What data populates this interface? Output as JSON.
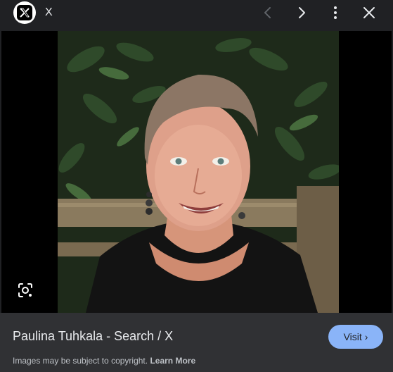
{
  "header": {
    "source_name": "X",
    "logo_glyph": "𝕏",
    "logo_icon": "x-logo-icon",
    "icons": {
      "previous": "chevron-left-icon",
      "next": "chevron-right-icon",
      "more": "more-vert-icon",
      "close": "close-icon"
    }
  },
  "viewer": {
    "lens_icon": "google-lens-icon"
  },
  "footer": {
    "title": "Paulina Tuhkala - Search / X",
    "visit_label": "Visit",
    "visit_chevron": "›",
    "copyright_text": "Images may be subject to copyright.",
    "learn_more_label": "Learn More"
  },
  "colors": {
    "background": "#202124",
    "footer_background": "#303134",
    "accent": "#8ab4f8",
    "text": "#e8eaed",
    "muted_text": "#bdc1c6"
  }
}
